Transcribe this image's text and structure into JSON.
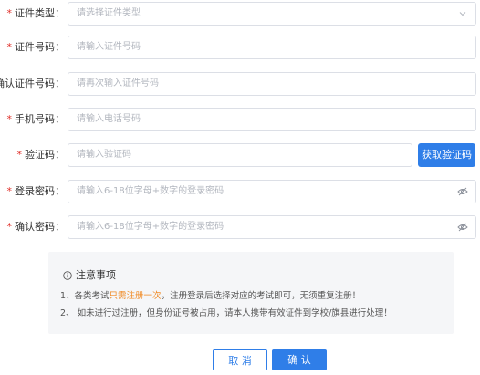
{
  "form": {
    "id_type": {
      "label": "证件类型",
      "placeholder": "请选择证件类型"
    },
    "id_number": {
      "label": "证件号码",
      "placeholder": "请输入证件号码"
    },
    "confirm_id_number": {
      "label": "确认证件号码",
      "placeholder": "请再次输入证件号码"
    },
    "phone": {
      "label": "手机号码",
      "placeholder": "请输入电话号码"
    },
    "code": {
      "label": "验证码",
      "placeholder": "请输入验证码",
      "button": "获取验证码"
    },
    "password": {
      "label": "登录密码",
      "placeholder": "请输入6-18位字母+数字的登录密码"
    },
    "confirm_password": {
      "label": "确认密码",
      "placeholder": "请输入6-18位字母+数字的登录密码"
    },
    "required_mark": "*",
    "colon": "："
  },
  "notice": {
    "title": "注意事项",
    "line1_prefix": "1、各类考试",
    "line1_highlight": "只需注册一次",
    "line1_suffix": "，注册登录后选择对应的考试即可，无须重复注册！",
    "line2": "2、 如未进行过注册，但身份证号被占用，请本人携带有效证件到学校/旗县进行处理！"
  },
  "actions": {
    "cancel": "取 消",
    "confirm": "确 认"
  },
  "colors": {
    "primary": "#2f7ee8",
    "required": "#e0302a",
    "highlight": "#f08a24"
  },
  "icons": {
    "select": "chevron-down-icon",
    "password": "eye-off-icon",
    "notice": "info-circle-icon"
  }
}
